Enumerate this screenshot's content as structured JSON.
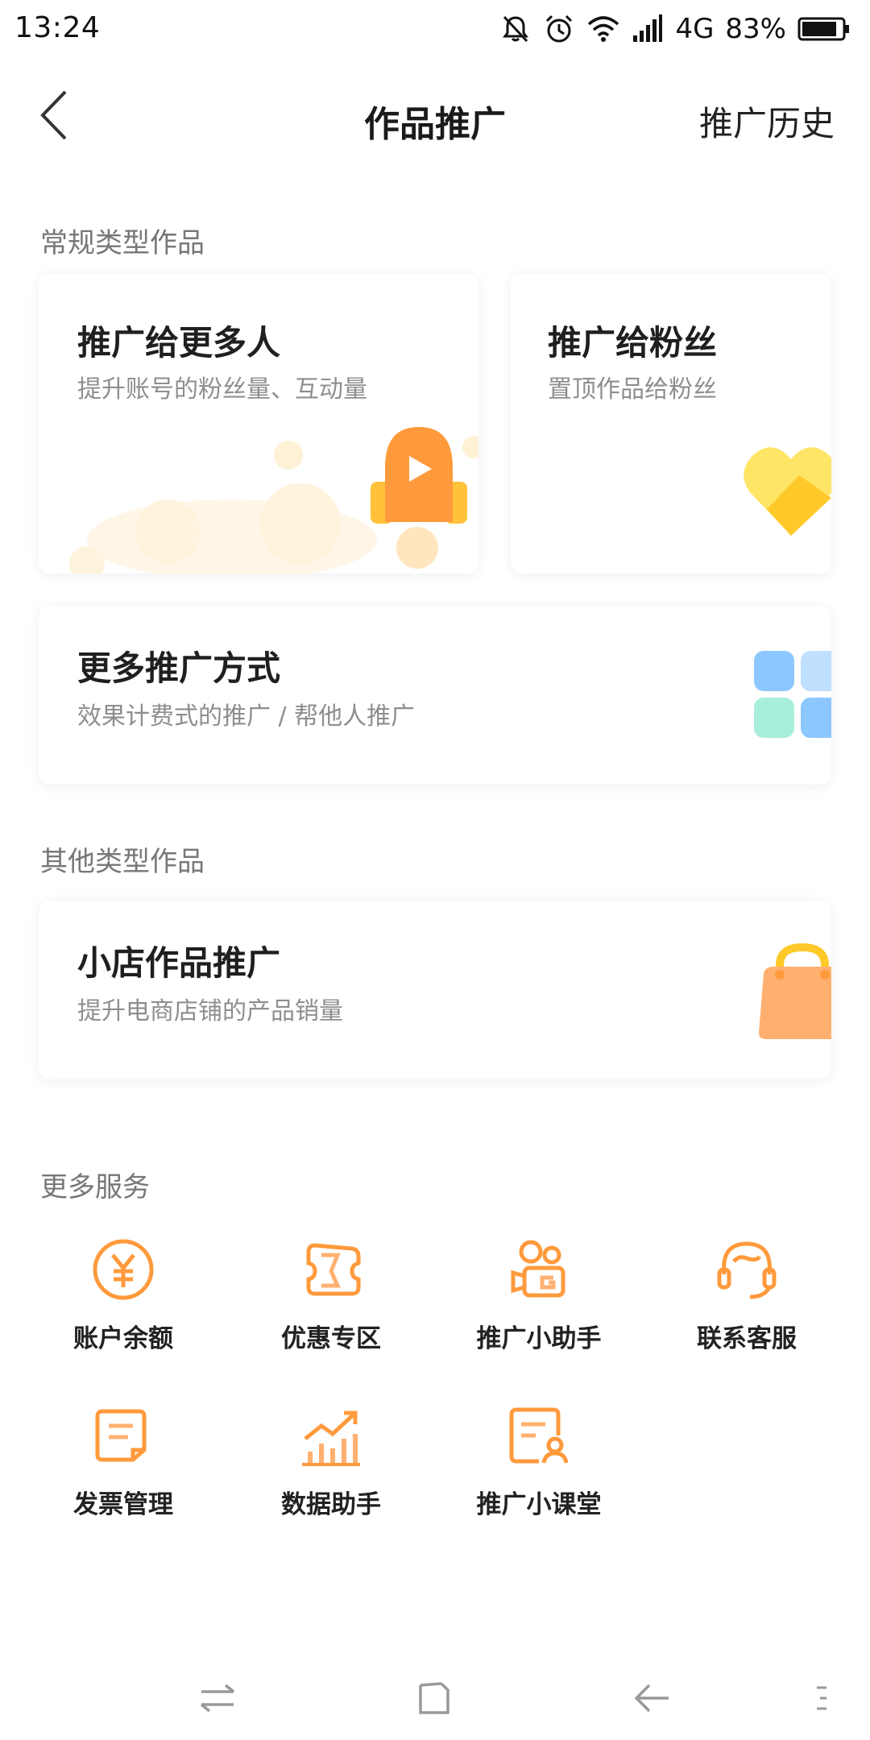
{
  "status_bar": {
    "time": "13:24",
    "network": "4G",
    "battery": "83%",
    "icons": [
      "bell-off-icon",
      "alarm-icon",
      "wifi-icon",
      "signal-icon",
      "battery-icon"
    ]
  },
  "nav": {
    "title": "作品推广",
    "history_label": "推广历史"
  },
  "sections": {
    "regular": {
      "header": "常规类型作品",
      "cards": [
        {
          "title": "推广给更多人",
          "desc": "提升账号的粉丝量、互动量",
          "icon": "rocket-icon"
        },
        {
          "title": "推广给粉丝",
          "desc": "置顶作品给粉丝",
          "icon": "heart-icon"
        },
        {
          "title": "更多推广方式",
          "desc": "效果计费式的推广 / 帮他人推广",
          "icon": "grid-icon"
        }
      ]
    },
    "other": {
      "header": "其他类型作品",
      "cards": [
        {
          "title": "小店作品推广",
          "desc": "提升电商店铺的产品销量",
          "icon": "shopping-bag-icon"
        }
      ]
    },
    "services": {
      "header": "更多服务",
      "items": [
        {
          "label": "账户余额",
          "icon": "yuan-icon"
        },
        {
          "label": "优惠专区",
          "icon": "ticket-icon"
        },
        {
          "label": "推广小助手",
          "icon": "assistant-icon"
        },
        {
          "label": "联系客服",
          "icon": "headset-icon"
        },
        {
          "label": "发票管理",
          "icon": "invoice-icon"
        },
        {
          "label": "数据助手",
          "icon": "chart-icon"
        },
        {
          "label": "推广小课堂",
          "icon": "classroom-icon"
        }
      ]
    }
  },
  "colors": {
    "accent_orange": "#FF9A3C",
    "heart_yellow": "#FFD233",
    "grid_blue": "#8CC8FF",
    "grid_mint": "#A8EEDC"
  }
}
